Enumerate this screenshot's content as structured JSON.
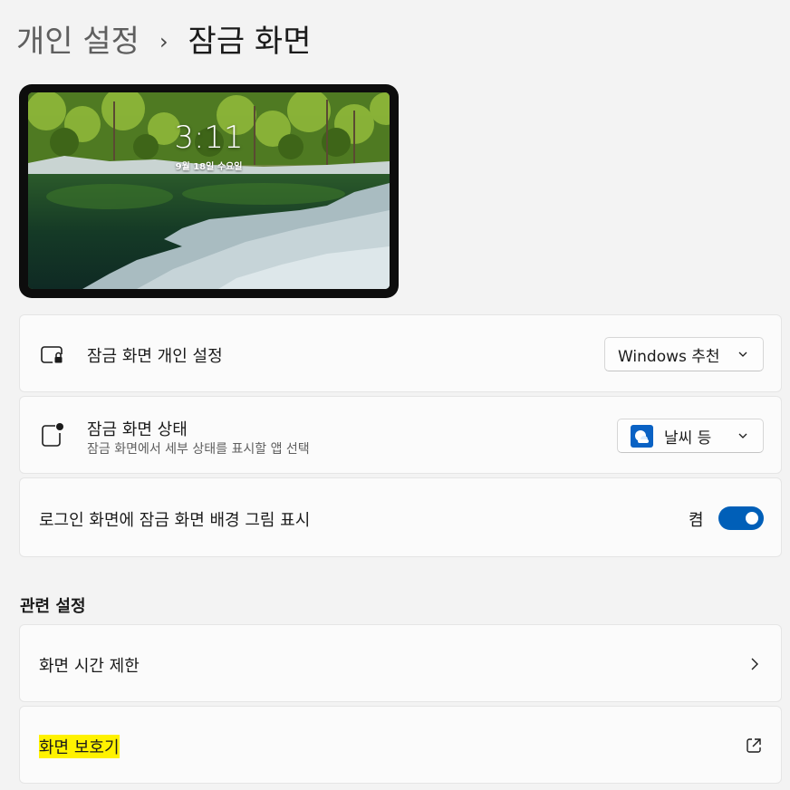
{
  "breadcrumb": {
    "parent": "개인 설정",
    "separator": "›",
    "current": "잠금 화면"
  },
  "lock_preview": {
    "time": "3:11",
    "date": "9월 18일 수요일"
  },
  "settings": {
    "personalize": {
      "title": "잠금 화면 개인 설정",
      "icon": "lock-screen-icon",
      "dropdown_value": "Windows 추천"
    },
    "status": {
      "title": "잠금 화면 상태",
      "subtitle": "잠금 화면에서 세부 상태를 표시할 앱 선택",
      "icon": "status-badge-icon",
      "dropdown_value": "날씨 등",
      "dropdown_icon": "weather-app-icon"
    },
    "signin_background": {
      "title": "로그인 화면에 잠금 화면 배경 그림 표시",
      "toggle_label": "켬",
      "toggle_on": true
    }
  },
  "related": {
    "title": "관련 설정",
    "items": [
      {
        "label": "화면 시간 제한",
        "icon": "chevron-right-icon"
      },
      {
        "label": "화면 보호기",
        "icon": "external-link-icon"
      }
    ]
  },
  "colors": {
    "accent": "#005fb8",
    "highlight": "#fff200"
  }
}
